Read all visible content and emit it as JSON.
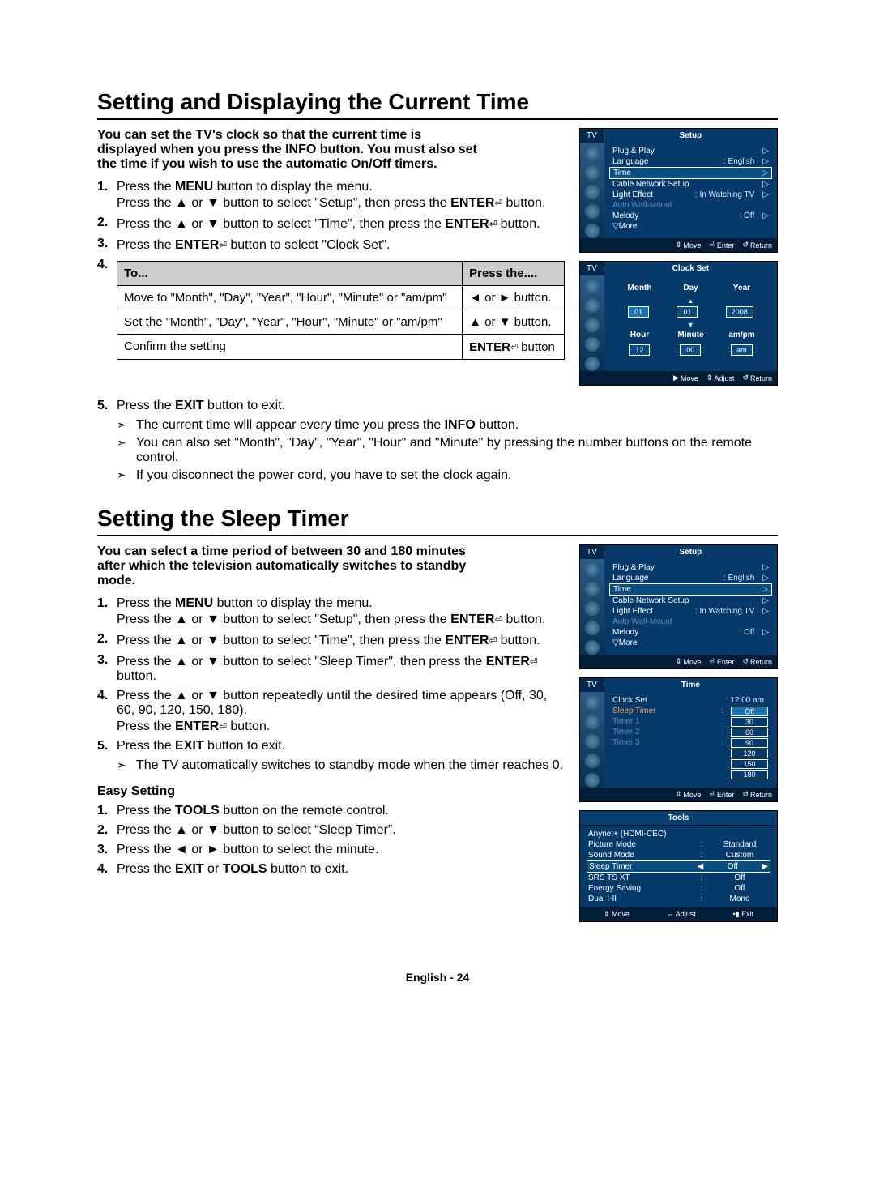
{
  "section1": {
    "title": "Setting and Displaying the Current Time",
    "intro": "You can set the TV's clock so that the current time is displayed when you press the INFO button. You must also set the time if you wish to use the automatic On/Off timers.",
    "step1a": "Press the ",
    "step1b": " button to display the menu.",
    "step1c": "Press the ▲ or ▼ button to select \"Setup\", then press the ",
    "step1d": " button.",
    "step2a": "Press the ▲ or ▼ button to select \"Time\", then press the ",
    "step2b": " button.",
    "step3a": "Press the ",
    "step3b": " button to select \"Clock Set\".",
    "tbl_h1": "To...",
    "tbl_h2": "Press the....",
    "tbl_r1c1": "Move to \"Month\", \"Day\", \"Year\", \"Hour\", \"Minute\" or \"am/pm\"",
    "tbl_r1c2": "◄ or ► button.",
    "tbl_r2c1": "Set the \"Month\", \"Day\", \"Year\", \"Hour\", \"Minute\" or \"am/pm\"",
    "tbl_r2c2": "▲ or ▼ button.",
    "tbl_r3c1": "Confirm the setting",
    "tbl_r3c2a": "ENTER",
    "tbl_r3c2b": " button",
    "step5a": "Press the ",
    "step5b": " button to exit.",
    "note1a": "The current time will appear every time you press the ",
    "note1b": " button.",
    "note2": "You can also set \"Month\", \"Day\", \"Year\", \"Hour\" and \"Minute\" by pressing the number buttons on the remote control.",
    "note3": "If you disconnect the power cord, you have to set the clock again.",
    "menu": "MENU",
    "enter": "ENTER",
    "exit": "EXIT",
    "info": "INFO",
    "tools": "TOOLS"
  },
  "section2": {
    "title": "Setting the Sleep Timer",
    "intro": "You can select a time period of between 30 and 180 minutes after which the television automatically switches to standby mode.",
    "step1a": "Press the ",
    "step1b": " button to display the menu.",
    "step1c": "Press the ▲ or ▼ button to select \"Setup\", then press the ",
    "step1d": " button.",
    "step2a": "Press the ▲ or ▼ button to select \"Time\", then press the ",
    "step2b": " button.",
    "step3a": "Press the ▲ or ▼ button to select \"Sleep Timer\", then press the ",
    "step3b": " button.",
    "step4a": "Press the ▲ or ▼ button repeatedly until the desired time appears (Off, 30, 60, 90, 120, 150, 180).",
    "step4b": "Press the ",
    "step4c": " button.",
    "step5a": "Press the ",
    "step5b": " button to exit.",
    "note1": "The TV automatically switches to standby mode when the timer reaches 0.",
    "easy_title": "Easy Setting",
    "es1a": "Press the ",
    "es1b": " button on the remote control.",
    "es2": "Press the ▲ or ▼ button to select “Sleep Timer”.",
    "es3": "Press the ◄ or ► button to select the minute.",
    "es4a": "Press the ",
    "es4or": " or ",
    "es4b": " button to exit."
  },
  "osd_setup": {
    "tv": "TV",
    "title": "Setup",
    "items": [
      {
        "lbl": "Plug & Play",
        "val": "",
        "chev": "▷"
      },
      {
        "lbl": "Language",
        "val": ": English",
        "chev": "▷"
      },
      {
        "lbl": "Time",
        "val": "",
        "chev": "▷",
        "hl": true
      },
      {
        "lbl": "Cable Network Setup",
        "val": "",
        "chev": "▷"
      },
      {
        "lbl": "Light Effect",
        "val": ": In Watching TV",
        "chev": "▷"
      },
      {
        "lbl": "Auto Wall-Mount",
        "val": "",
        "dim": true
      },
      {
        "lbl": "Melody",
        "val": ": Off",
        "chev": "▷"
      },
      {
        "lbl": "▽More",
        "val": ""
      }
    ],
    "foot_move": "Move",
    "foot_enter": "Enter",
    "foot_return": "Return"
  },
  "osd_clock": {
    "tv": "TV",
    "title": "Clock Set",
    "labels1": [
      "Month",
      "Day",
      "Year"
    ],
    "values1": [
      "01",
      "01",
      "2008"
    ],
    "labels2": [
      "Hour",
      "Minute",
      "am/pm"
    ],
    "values2": [
      "12",
      "00",
      "am"
    ],
    "foot_move": "Move",
    "foot_adjust": "Adjust",
    "foot_return": "Return"
  },
  "osd_time": {
    "tv": "TV",
    "title": "Time",
    "clock_set_lbl": "Clock Set",
    "clock_set_val": ": 12:00 am",
    "sleep_lbl": "Sleep Timer",
    "timer1": "Timer 1",
    "timer2": "Timer 2",
    "timer3": "Timer 3",
    "opts": [
      "Off",
      "30",
      "60",
      "90",
      "120",
      "150",
      "180"
    ],
    "foot_move": "Move",
    "foot_enter": "Enter",
    "foot_return": "Return"
  },
  "osd_tools": {
    "title": "Tools",
    "rows": [
      {
        "l": "Anynet+ (HDMI-CEC)",
        "c": "",
        "v": ""
      },
      {
        "l": "Picture Mode",
        "c": ":",
        "v": "Standard"
      },
      {
        "l": "Sound Mode",
        "c": ":",
        "v": "Custom"
      },
      {
        "l": "Sleep Timer",
        "c": "",
        "v": "Off",
        "hl": true,
        "arrows": true
      },
      {
        "l": "SRS TS XT",
        "c": ":",
        "v": "Off"
      },
      {
        "l": "Energy Saving",
        "c": ":",
        "v": "Off"
      },
      {
        "l": "Dual I-II",
        "c": ":",
        "v": "Mono"
      }
    ],
    "foot_move": "Move",
    "foot_adjust": "Adjust",
    "foot_exit": "Exit"
  },
  "footer": "English - 24",
  "glyph": {
    "enter": "⏎",
    "updown": "⇕",
    "lr": "⇔",
    "ret": "↺",
    "tri_r": "▶",
    "tri_l": "◀",
    "exit": "•▮"
  }
}
